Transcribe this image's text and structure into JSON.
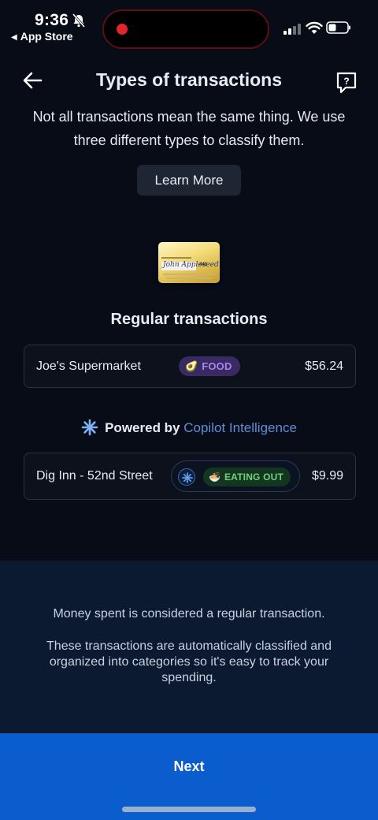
{
  "status_bar": {
    "time": "9:36",
    "back_app": "App Store",
    "back_indicator": "◀"
  },
  "header": {
    "title": "Types of transactions"
  },
  "intro": {
    "text": "Not all transactions mean the same thing. We use three different types to classify them."
  },
  "learn_more_label": "Learn More",
  "card": {
    "signature": "John Appleseed",
    "cvv": "440"
  },
  "section_title": "Regular transactions",
  "transactions": [
    {
      "name": "Joe's Supermarket",
      "category": "FOOD",
      "category_emoji": "🥑",
      "amount": "$56.24"
    },
    {
      "name": "Dig Inn - 52nd Street",
      "category": "EATING OUT",
      "category_emoji": "🍜",
      "amount": "$9.99"
    }
  ],
  "powered_by": {
    "prefix": "Powered by",
    "brand": "Copilot Intelligence"
  },
  "info": {
    "line1": "Money spent is considered a regular transaction.",
    "line2": "These transactions are automatically classified and organized into categories so it's easy to track your spending."
  },
  "next_label": "Next",
  "colors": {
    "background": "#070c17",
    "accent": "#0b5ccc",
    "brand_blue": "#5f8fd6",
    "food_purple": "#a784f0",
    "eating_green": "#6fd27f"
  },
  "icons": {
    "back": "arrow-left-icon",
    "help": "help-chat-icon",
    "sparkle": "sparkle-icon",
    "bell": "bell-slash-icon"
  }
}
